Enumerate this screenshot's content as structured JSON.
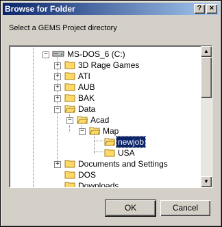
{
  "window": {
    "title": "Browse for Folder",
    "help_label": "?",
    "close_label": "×"
  },
  "prompt": "Select a GEMS Project directory",
  "tree": {
    "items": [
      {
        "label": "MS-DOS_6 (C:)",
        "expander": "−",
        "icon": "drive-icon"
      },
      {
        "label": "3D Rage Games",
        "expander": "+",
        "icon": "folder-icon"
      },
      {
        "label": "ATI",
        "expander": "+",
        "icon": "folder-icon"
      },
      {
        "label": "AUB",
        "expander": "+",
        "icon": "folder-icon"
      },
      {
        "label": "BAK",
        "expander": "+",
        "icon": "folder-icon"
      },
      {
        "label": "Data",
        "expander": "−",
        "icon": "folder-open-icon"
      },
      {
        "label": "Acad",
        "expander": "−",
        "icon": "folder-open-icon"
      },
      {
        "label": "Map",
        "expander": "−",
        "icon": "folder-open-icon"
      },
      {
        "label": "newjob",
        "expander": "",
        "icon": "folder-open-icon",
        "selected": true
      },
      {
        "label": "USA",
        "expander": "",
        "icon": "folder-icon"
      },
      {
        "label": "Documents and Settings",
        "expander": "+",
        "icon": "folder-icon"
      },
      {
        "label": "DOS",
        "expander": "",
        "icon": "folder-icon"
      },
      {
        "label": "Downloads",
        "expander": "",
        "icon": "folder-icon"
      }
    ]
  },
  "scrollbar": {
    "up_glyph": "▲",
    "down_glyph": "▼"
  },
  "buttons": {
    "ok": "OK",
    "cancel": "Cancel"
  }
}
